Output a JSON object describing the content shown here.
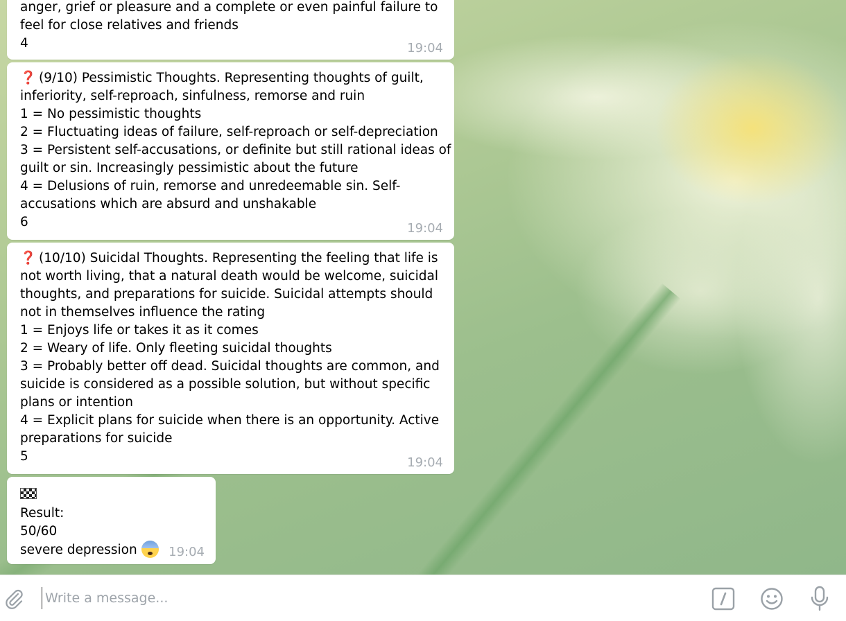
{
  "messages": [
    {
      "lines": [
        "anger, grief or pleasure and a complete or even painful failure to",
        "feel for close relatives and friends",
        "4"
      ],
      "time": "19:04"
    },
    {
      "lines": [
        "(9/10) Pessimistic Thoughts. Representing thoughts of guilt,",
        "inferiority, self-reproach, sinfulness, remorse and ruin",
        "1 = No pessimistic thoughts",
        "2 = Fluctuating ideas of failure, self-reproach or self-depreciation",
        "3 = Persistent self-accusations, or definite but still rational ideas of",
        "guilt or sin. Increasingly pessimistic about the future",
        "4 = Delusions of ruin, remorse and unredeemable sin. Self-",
        "accusations which are absurd and unshakable",
        "6"
      ],
      "time": "19:04"
    },
    {
      "lines": [
        "(10/10) Suicidal Thoughts. Representing the feeling that life is",
        "not worth living, that a natural death would be welcome, suicidal",
        "thoughts, and preparations for suicide. Suicidal attempts should",
        "not in themselves influence the rating",
        "1 = Enjoys life or takes it as it comes",
        "2 = Weary of life. Only fleeting suicidal thoughts",
        "3 = Probably better off dead. Suicidal thoughts are common, and",
        "suicide is considered as a possible solution, but without specific",
        "plans or intention",
        "4 = Explicit plans for suicide when there is an opportunity. Active",
        "preparations for suicide",
        "5"
      ],
      "time": "19:04"
    },
    {
      "lines": [
        "Result:",
        "50/60",
        "severe depression"
      ],
      "time": "19:04"
    }
  ],
  "icons": {
    "question": "red-question-mark-emoji",
    "flag": "checkered-flag-emoji",
    "face": "anxious-face-emoji"
  },
  "composer": {
    "placeholder": "Write a message..."
  }
}
